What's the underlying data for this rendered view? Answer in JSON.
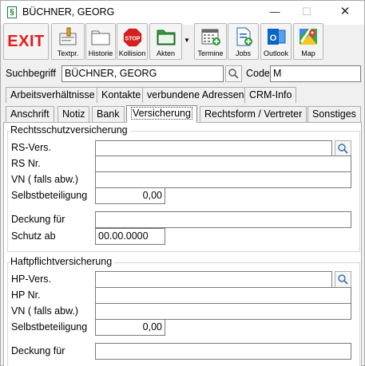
{
  "window": {
    "title": "BÜCHNER, GEORG",
    "app_icon_glyph": "§",
    "min_glyph": "—",
    "max_glyph": "☐",
    "close_glyph": "✕"
  },
  "toolbar": {
    "exit_label": "EXIT",
    "buttons": [
      {
        "label": "Textpr.",
        "icon": "text-processing-icon"
      },
      {
        "label": "Historie",
        "icon": "folder-icon"
      },
      {
        "label": "Kollision",
        "icon": "stop-sign-icon",
        "icon_text": "STOP"
      },
      {
        "label": "Akten",
        "icon": "green-folder-icon"
      },
      {
        "label": "Termine",
        "icon": "calendar-icon"
      },
      {
        "label": "Jobs",
        "icon": "document-add-icon"
      },
      {
        "label": "Outlook",
        "icon": "outlook-icon",
        "icon_text": "O"
      },
      {
        "label": "Map",
        "icon": "map-icon"
      }
    ],
    "akten_dropdown_glyph": "▼"
  },
  "search": {
    "label": "Suchbegriff",
    "value": "BÜCHNER, GEORG",
    "code_label": "Code",
    "code_value": "M"
  },
  "tabs_row1": [
    "Arbeitsverhältnisse",
    "Kontakte",
    "verbundene Adressen",
    "CRM-Info"
  ],
  "tabs_row2": [
    "Anschrift",
    "Notiz",
    "Bank",
    "Versicherung",
    "Rechtsform / Vertreter",
    "Sonstiges"
  ],
  "active_tab": "Versicherung",
  "rechtsschutz": {
    "title": "Rechtsschutzversicherung",
    "rs_vers_label": "RS-Vers.",
    "rs_vers_value": "",
    "rs_nr_label": "RS Nr.",
    "rs_nr_value": "",
    "vn_label": "VN ( falls abw.)",
    "vn_value": "",
    "selbst_label": "Selbstbeteiligung",
    "selbst_value": "0,00",
    "deckung_label": "Deckung für",
    "deckung_value": "",
    "schutz_label": "Schutz ab",
    "schutz_value": "00.00.0000"
  },
  "haftpflicht": {
    "title": "Haftpflichtversicherung",
    "hp_vers_label": "HP-Vers.",
    "hp_vers_value": "",
    "hp_nr_label": "HP Nr.",
    "hp_nr_value": "",
    "vn_label": "VN ( falls abw.)",
    "vn_value": "",
    "selbst_label": "Selbstbeteiligung",
    "selbst_value": "0,00",
    "deckung_label": "Deckung für",
    "deckung_value": ""
  },
  "colors": {
    "exit_red": "#e01e1e",
    "akten_green": "#2e9d3a",
    "outlook_blue": "#0a64c8",
    "stop_red": "#d42020"
  }
}
